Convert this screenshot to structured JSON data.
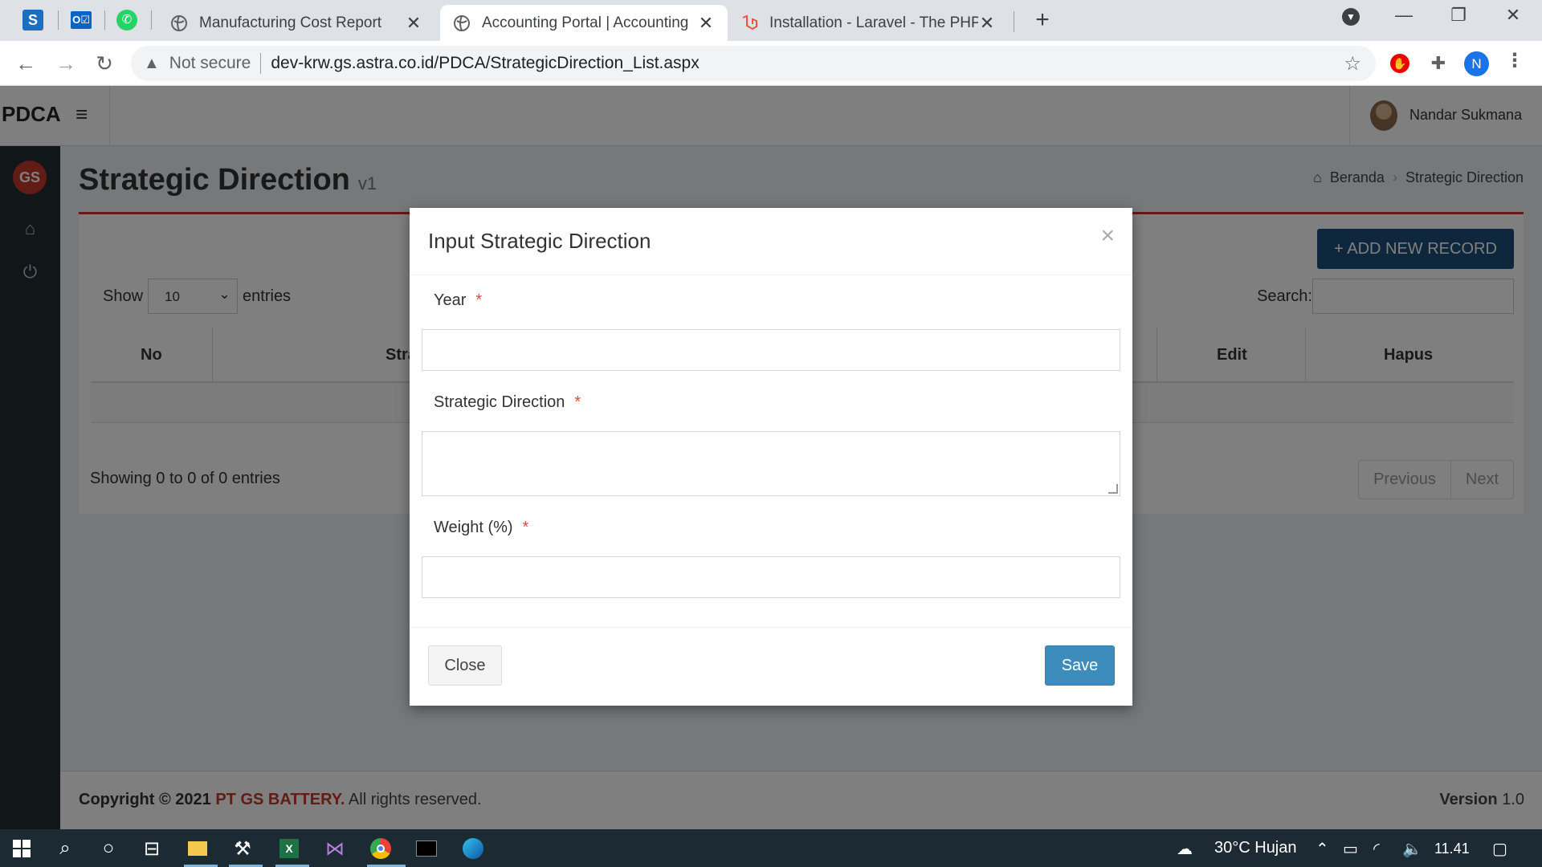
{
  "browser": {
    "tabs": [
      {
        "title": "Manufacturing Cost Report",
        "active": false
      },
      {
        "title": "Accounting Portal | Accounting",
        "active": true
      },
      {
        "title": "Installation - Laravel - The PHP Fr",
        "active": false
      }
    ],
    "security_label": "Not secure",
    "url": "dev-krw.gs.astra.co.id/PDCA/StrategicDirection_List.aspx",
    "profile_initial": "N"
  },
  "app": {
    "brand": "PDCA",
    "user_name": "Nandar Sukmana",
    "logo_text": "GS",
    "page_title": "Strategic Direction",
    "page_version": "v1",
    "breadcrumb": {
      "home": "Beranda",
      "current": "Strategic Direction"
    },
    "add_button": "+ ADD NEW RECORD",
    "table": {
      "show_label": "Show",
      "page_length": "10",
      "entries_label": "entries",
      "search_label": "Search:",
      "columns": [
        "No",
        "Stra",
        "Edit",
        "Hapus"
      ],
      "info": "Showing 0 to 0 of 0 entries",
      "prev": "Previous",
      "next": "Next"
    },
    "footer": {
      "copyright": "Copyright © 2021",
      "company": "PT GS BATTERY.",
      "rights": "All rights reserved.",
      "version_label": "Version",
      "version": "1.0"
    }
  },
  "modal": {
    "title": "Input Strategic Direction",
    "close_x": "×",
    "fields": [
      {
        "label": "Year",
        "required": "*",
        "value": ""
      },
      {
        "label": "Strategic Direction",
        "required": "*",
        "value": ""
      },
      {
        "label": "Weight (%)",
        "required": "*",
        "value": ""
      }
    ],
    "close_button": "Close",
    "save_button": "Save"
  },
  "taskbar": {
    "weather": "30°C  Hujan",
    "time": "11.41"
  },
  "colors": {
    "accent_red": "#c0392b",
    "primary_dark": "#1f4e79",
    "save_blue": "#3c8dbc",
    "sidebar": "#222d32"
  }
}
